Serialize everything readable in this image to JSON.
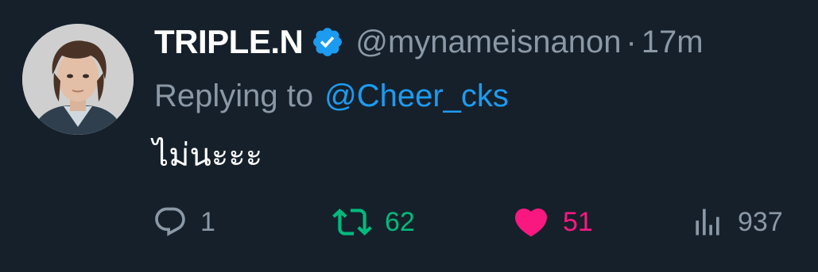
{
  "tweet": {
    "display_name": "TRIPLE.N",
    "verified_icon": "verified-badge-icon",
    "handle": "@mynameisnanon",
    "separator": "·",
    "time": "17m",
    "reply_prefix": "Replying to",
    "reply_to": "@Cheer_cks",
    "text": "ไม่นะะะ"
  },
  "actions": {
    "reply": {
      "icon": "reply-icon",
      "count": "1",
      "color": "#8b98a5"
    },
    "retweet": {
      "icon": "retweet-icon",
      "count": "62",
      "color": "#00ba7c"
    },
    "like": {
      "icon": "heart-icon",
      "count": "51",
      "color": "#f91880"
    },
    "views": {
      "icon": "views-icon",
      "count": "937",
      "color": "#8b98a5"
    }
  },
  "colors": {
    "background": "#15202b",
    "primary_text": "#ffffff",
    "secondary_text": "#8b98a5",
    "link": "#1d9bf0"
  }
}
